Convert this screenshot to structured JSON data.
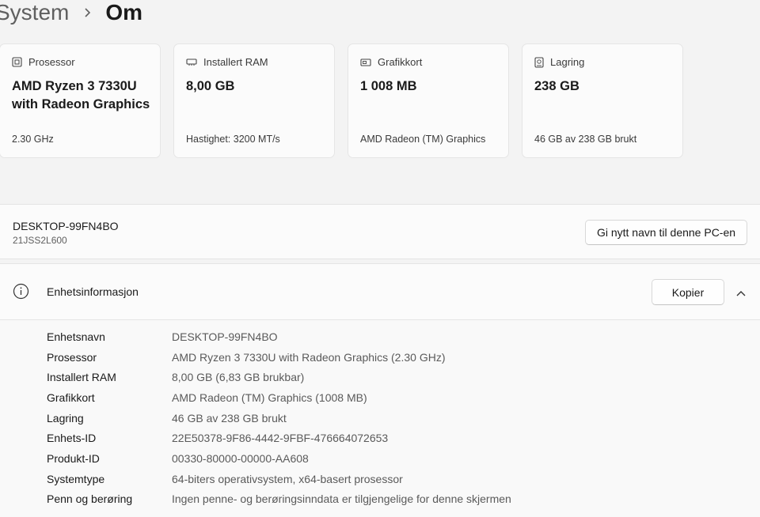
{
  "breadcrumb": {
    "parent": "System",
    "separator_icon": "chevron-right-icon",
    "current": "Om"
  },
  "cards": [
    {
      "icon": "processor-icon",
      "label": "Prosessor",
      "value": "AMD Ryzen 3 7330U with Radeon Graphics",
      "sub": "2.30 GHz"
    },
    {
      "icon": "ram-icon",
      "label": "Installert RAM",
      "value": "8,00 GB",
      "sub": "Hastighet: 3200 MT/s"
    },
    {
      "icon": "graphics-card-icon",
      "label": "Grafikkort",
      "value": "1 008 MB",
      "sub": "AMD Radeon (TM) Graphics"
    },
    {
      "icon": "storage-icon",
      "label": "Lagring",
      "value": "238 GB",
      "sub": "46 GB av 238 GB brukt"
    }
  ],
  "device": {
    "name": "DESKTOP-99FN4BO",
    "model": "21JSS2L600",
    "rename_label": "Gi nytt navn til denne PC-en"
  },
  "device_info": {
    "icon": "info-icon",
    "title": "Enhetsinformasjon",
    "copy_label": "Kopier",
    "collapse_icon": "chevron-up-icon",
    "specs": [
      {
        "label": "Enhetsnavn",
        "value": "DESKTOP-99FN4BO"
      },
      {
        "label": "Prosessor",
        "value": "AMD Ryzen 3 7330U with Radeon Graphics (2.30 GHz)"
      },
      {
        "label": "Installert RAM",
        "value": "8,00 GB (6,83 GB brukbar)"
      },
      {
        "label": "Grafikkort",
        "value": "AMD Radeon (TM) Graphics (1008 MB)"
      },
      {
        "label": "Lagring",
        "value": "46 GB av 238 GB brukt"
      },
      {
        "label": "Enhets-ID",
        "value": "22E50378-9F86-4442-9FBF-476664072653"
      },
      {
        "label": "Produkt-ID",
        "value": "00330-80000-00000-AA608"
      },
      {
        "label": "Systemtype",
        "value": "64-biters operativsystem, x64-basert prosessor"
      },
      {
        "label": "Penn og berøring",
        "value": "Ingen penne- og berøringsinndata er tilgjengelige for denne skjermen"
      }
    ]
  }
}
